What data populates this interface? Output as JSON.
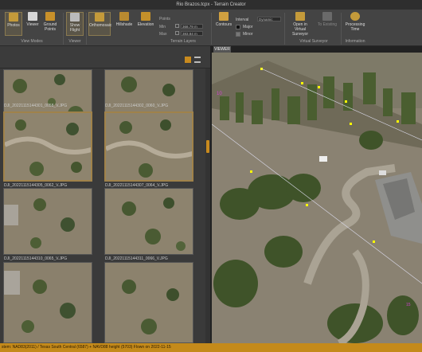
{
  "window": {
    "title": "Rio Brazos.tcpx  -  Terrain Creator"
  },
  "ribbon": {
    "photos": "Photos",
    "viewer": "Viewer",
    "ground_points": "Ground Points",
    "view_modes_group": "View Modes",
    "show_flight": "Show Flight",
    "viewer_group": "Viewer",
    "orthomosaic": "Orthomosaic",
    "hillshade": "Hillshade",
    "elevation": "Elevation",
    "terrain_layers_label": "Points",
    "min_label": "Min",
    "max_label": "Max",
    "min_value": "368.79 m",
    "max_value": "383.84 m",
    "terrain_layers_group": "Terrain Layers",
    "contours": "Contours",
    "interval_label": "Interval",
    "interval_value": "Dynamic",
    "major_label": "Major",
    "minor_label": "Minor",
    "open_virtual_surveyor": "Open in Virtual Surveyor",
    "to_existing": "To Existing",
    "virtual_surveyor_group": "Virtual Surveyor",
    "processing_time": "Processing Time",
    "information_group": "Information"
  },
  "viewer_tab": "VIEWER",
  "photos": [
    {
      "label": "DJI_20221115144301_0058_V.JPG"
    },
    {
      "label": "DJI_20221115144302_0060_V.JPG"
    },
    {
      "label": "DJI_20221115144305_0062_V.JPG"
    },
    {
      "label": "DJI_20221115144307_0064_V.JPG"
    },
    {
      "label": "DJI_20221115144310_0065_V.JPG"
    },
    {
      "label": "DJI_20221115144311_0066_V.JPG"
    }
  ],
  "status": {
    "text": "stem: NAD83(2011) / Texas South Central (6587) + NAVD88 height (5703)        Flown on 2022-11-15"
  },
  "colors": {
    "accent": "#c48a1a",
    "selected_border": "#a0824a"
  }
}
